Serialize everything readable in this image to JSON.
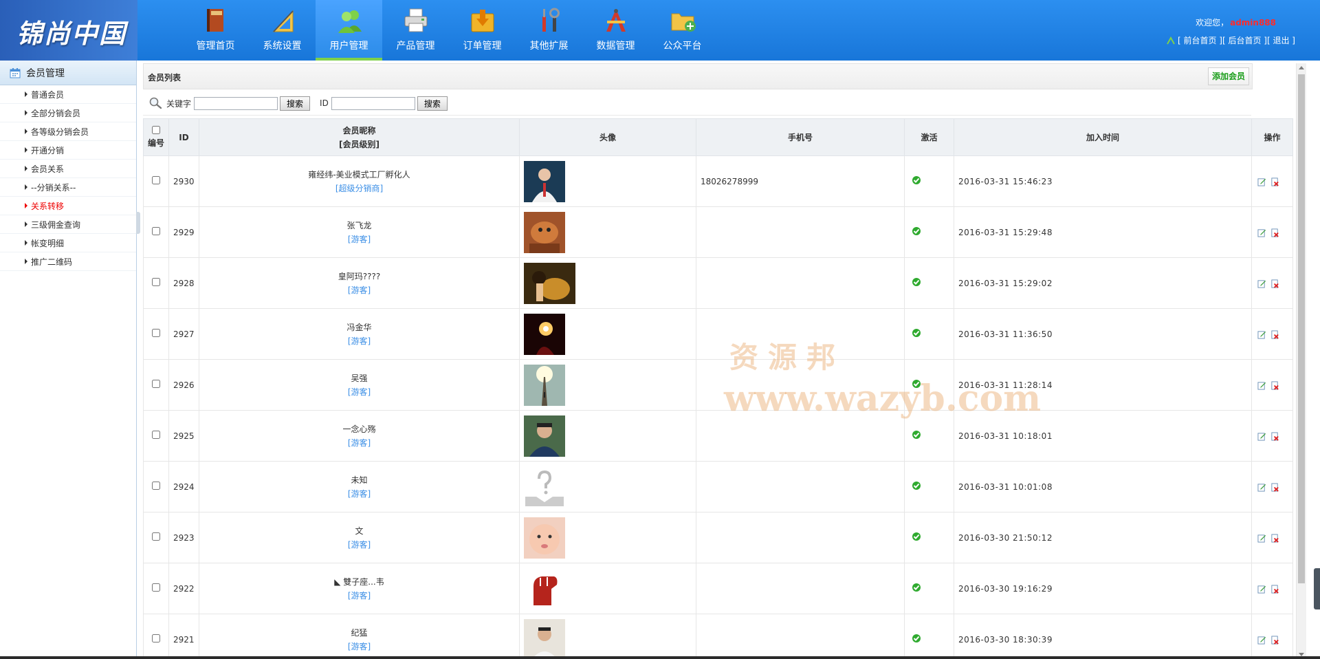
{
  "header": {
    "logo_text": "锦尚中国",
    "nav": [
      {
        "label": "管理首页",
        "icon": "book-icon",
        "active": false
      },
      {
        "label": "系统设置",
        "icon": "ruler-icon",
        "active": false
      },
      {
        "label": "用户管理",
        "icon": "users-icon",
        "active": true
      },
      {
        "label": "产品管理",
        "icon": "printer-icon",
        "active": false
      },
      {
        "label": "订单管理",
        "icon": "download-box-icon",
        "active": false
      },
      {
        "label": "其他扩展",
        "icon": "tools-icon",
        "active": false
      },
      {
        "label": "数据管理",
        "icon": "compass-icon",
        "active": false
      },
      {
        "label": "公众平台",
        "icon": "folder-add-icon",
        "active": false
      }
    ],
    "welcome_prefix": "欢迎您，",
    "username": "admin888",
    "links": {
      "front": "[ 前台首页 ]",
      "back": "[ 后台首页 ]",
      "logout": "[ 退出 ]"
    }
  },
  "sidebar": {
    "title": "会员管理",
    "items": [
      {
        "label": "普通会员"
      },
      {
        "label": "全部分销会员"
      },
      {
        "label": "各等级分销会员"
      },
      {
        "label": "开通分销"
      },
      {
        "label": "会员关系"
      },
      {
        "label": "--分销关系--"
      },
      {
        "label": "关系转移",
        "active": true
      },
      {
        "label": "三级佣金查询"
      },
      {
        "label": "帐变明细"
      },
      {
        "label": "推广二维码"
      }
    ]
  },
  "list": {
    "title": "会员列表",
    "add_button": "添加会员",
    "search": {
      "keyword_label": "关键字",
      "keyword_value": "",
      "button": "搜索",
      "id_label": "ID",
      "id_value": "",
      "id_button": "搜索"
    },
    "columns": {
      "num": "编号",
      "id": "ID",
      "nick": "会员昵称",
      "level": "[会员级别]",
      "avatar": "头像",
      "phone": "手机号",
      "active": "激活",
      "time": "加入时间",
      "ops": "操作"
    },
    "rows": [
      {
        "id": "2930",
        "name": "雍经纬-美业模式工厂孵化人",
        "level": "[超级分销商]",
        "phone": "18026278999",
        "time": "2016-03-31 15:46:23",
        "avatar": "suit-man",
        "wide": false
      },
      {
        "id": "2929",
        "name": "张飞龙",
        "level": "[游客]",
        "phone": "",
        "time": "2016-03-31 15:29:48",
        "avatar": "dog",
        "wide": false
      },
      {
        "id": "2928",
        "name": "皇阿玛????",
        "level": "[游客]",
        "phone": "",
        "time": "2016-03-31 15:29:02",
        "avatar": "lion-woman",
        "wide": true
      },
      {
        "id": "2927",
        "name": "冯金华",
        "level": "[游客]",
        "phone": "",
        "time": "2016-03-31 11:36:50",
        "avatar": "sparkler",
        "wide": false
      },
      {
        "id": "2926",
        "name": "吴强",
        "level": "[游客]",
        "phone": "",
        "time": "2016-03-31 11:28:14",
        "avatar": "light-path",
        "wide": false
      },
      {
        "id": "2925",
        "name": "一念心殇",
        "level": "[游客]",
        "phone": "",
        "time": "2016-03-31 10:18:01",
        "avatar": "young-man",
        "wide": false
      },
      {
        "id": "2924",
        "name": "未知",
        "level": "[游客]",
        "phone": "",
        "time": "2016-03-31 10:01:08",
        "avatar": "unknown",
        "wide": false
      },
      {
        "id": "2923",
        "name": "文",
        "level": "[游客]",
        "phone": "",
        "time": "2016-03-30 21:50:12",
        "avatar": "baby",
        "wide": false
      },
      {
        "id": "2922",
        "name": "◣ 雙子座...韦",
        "level": "[游客]",
        "phone": "",
        "time": "2016-03-30 19:16:29",
        "avatar": "red-fist",
        "wide": false
      },
      {
        "id": "2921",
        "name": "纪猛",
        "level": "[游客]",
        "phone": "",
        "time": "2016-03-30 18:30:39",
        "avatar": "office-man",
        "wide": false
      }
    ]
  },
  "watermark": {
    "line1": "资源邦",
    "line2": "www.wazyb.com"
  },
  "colors": {
    "header": "#1876d9",
    "active_nav": "#2b8be8",
    "level_link": "#3a8ee6",
    "username": "#ff2b2b",
    "active_side": "#ee0000",
    "add_button": "#1a9d1a"
  }
}
